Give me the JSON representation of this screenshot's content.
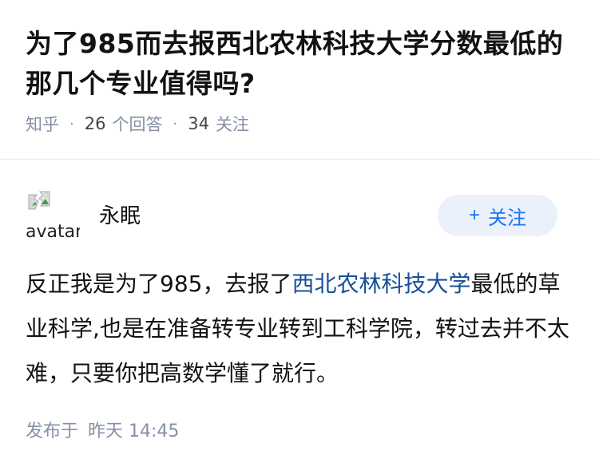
{
  "question": {
    "title": "为了985而去报西北农林科技大学分数最低的那几个专业值得吗?",
    "source": "知乎",
    "answer_count": "26",
    "answer_label": "个回答",
    "follow_count": "34",
    "follow_label": "关注"
  },
  "answer": {
    "author_name": "永眠",
    "avatar_alt": "avatar",
    "follow_button": "关注",
    "content_before": "反正我是为了985，去报了",
    "content_link": "西北农林科技大学",
    "content_after": "最低的草业科学,也是在准备转专业转到工科学院，转过去并不太难，只要你把高数学懂了就行。",
    "publish_label": "发布于",
    "publish_time": "昨天 14:45"
  },
  "colors": {
    "accent": "#1772f6",
    "link": "#175199",
    "meta": "#8590a6",
    "button_bg": "#eaf1fb"
  },
  "icons": [
    "dot-separator-icon",
    "broken-image-icon",
    "plus-icon"
  ]
}
